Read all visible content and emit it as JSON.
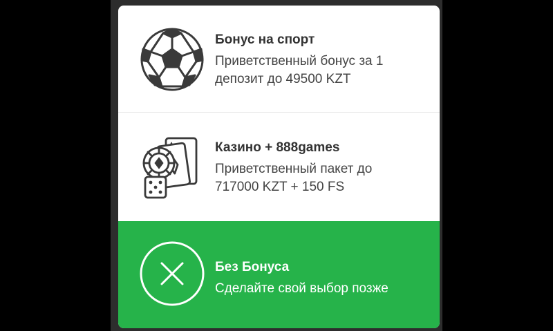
{
  "options": [
    {
      "title": "Бонус на спорт",
      "desc_line1": "Приветственный бонус за 1",
      "desc_line2": "депозит до 49500 KZT",
      "icon": "soccer-ball-icon"
    },
    {
      "title": "Казино + 888games",
      "desc_line1": "Приветственный пакет до",
      "desc_line2": "717000 KZT + 150 FS",
      "icon": "casino-chip-cards-dice-icon"
    },
    {
      "title": "Без Бонуса",
      "desc_line1": "Сделайте свой выбор позже",
      "icon": "close-circle-icon"
    }
  ],
  "colors": {
    "accent_green": "#26b34a",
    "icon_stroke": "#3a3a3a",
    "backdrop": "#2d2d2d"
  }
}
